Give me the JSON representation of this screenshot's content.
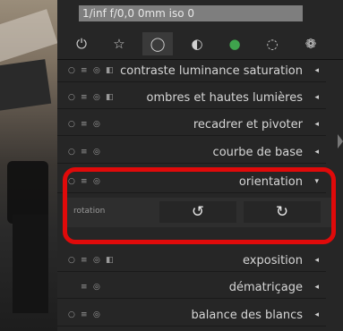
{
  "info_bar": "1/inf f/0,0 0mm iso 0",
  "groups": [
    {
      "icon": "power-icon",
      "glyph": "⏻",
      "active": false
    },
    {
      "icon": "star-icon",
      "glyph": "☆",
      "active": false
    },
    {
      "icon": "circle-icon",
      "glyph": "◯",
      "active": true
    },
    {
      "icon": "half-circle-icon",
      "glyph": "◐",
      "active": false
    },
    {
      "icon": "color-circle-icon",
      "glyph": "●",
      "active": false
    },
    {
      "icon": "correct-icon",
      "glyph": "◌",
      "active": false
    },
    {
      "icon": "effects-icon",
      "glyph": "❁",
      "active": false
    }
  ],
  "modules": [
    {
      "label": "contraste luminance saturation",
      "expanded": false,
      "icons": [
        "○",
        "≡",
        "◎",
        "◧"
      ]
    },
    {
      "label": "ombres et hautes lumières",
      "expanded": false,
      "icons": [
        "○",
        "≡",
        "◎",
        "◧"
      ]
    },
    {
      "label": "recadrer et pivoter",
      "expanded": false,
      "icons": [
        "○",
        "≡",
        "◎"
      ]
    },
    {
      "label": "courbe de base",
      "expanded": false,
      "icons": [
        "○",
        "≡",
        "◎"
      ]
    },
    {
      "label": "orientation",
      "expanded": true,
      "icons": [
        "○",
        "≡",
        "◎"
      ]
    },
    {
      "label": "exposition",
      "expanded": false,
      "icons": [
        "○",
        "≡",
        "◎",
        "◧"
      ]
    },
    {
      "label": "dématriçage",
      "expanded": false,
      "icons": [
        "≡",
        "◎"
      ]
    },
    {
      "label": "balance des blancs",
      "expanded": false,
      "icons": [
        "○",
        "≡",
        "◎"
      ]
    }
  ],
  "orientation": {
    "rotation_label": "rotation",
    "rotate_ccw_glyph": "↺",
    "rotate_cw_glyph": "↻"
  },
  "colors": {
    "highlight": "#e00a0a",
    "panel": "#262626"
  }
}
